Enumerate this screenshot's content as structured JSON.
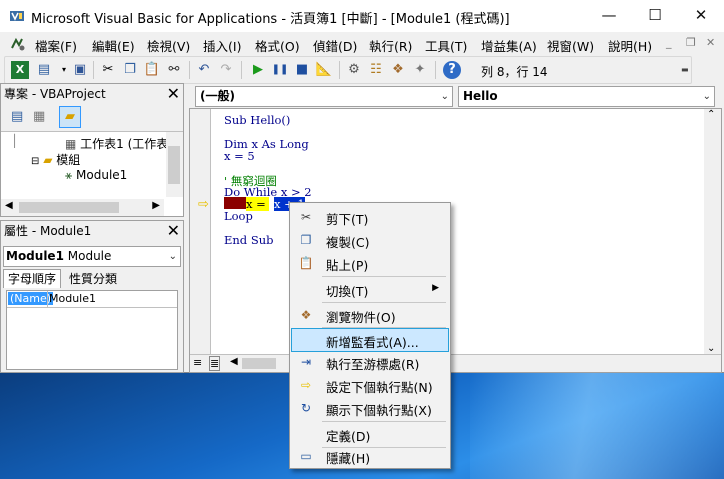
{
  "window": {
    "title": "Microsoft Visual Basic for Applications - 活頁簿1 [中斷] - [Module1 (程式碼)]",
    "controls": {
      "minimize": "—",
      "maximize": "☐",
      "close": "✕"
    }
  },
  "menubar": {
    "items": [
      "檔案(F)",
      "編輯(E)",
      "檢視(V)",
      "插入(I)",
      "格式(O)",
      "偵錯(D)",
      "執行(R)",
      "工具(T)",
      "增益集(A)",
      "視窗(W)",
      "說明(H)"
    ],
    "child_controls": {
      "minimize": "_",
      "restore": "❐",
      "close": "✕"
    }
  },
  "toolbar": {
    "position_label": "列 8，行 14",
    "icons": [
      "excel-icon",
      "insert-module-icon",
      "save-icon",
      "cut-icon",
      "copy-icon",
      "paste-icon",
      "find-icon",
      "undo-icon",
      "redo-icon",
      "run-icon",
      "pause-icon",
      "stop-icon",
      "design-mode-icon",
      "project-explorer-icon",
      "properties-icon",
      "object-browser-icon",
      "toolbox-icon",
      "help-icon"
    ]
  },
  "project_pane": {
    "title": "專案 - VBAProject",
    "tree": {
      "worksheet": "工作表1 (工作表",
      "modules_folder": "模組",
      "module": "Module1"
    }
  },
  "properties_pane": {
    "title": "屬性 - Module1",
    "object_name": "Module1",
    "object_type": "Module",
    "tabs": [
      "字母順序",
      "性質分類"
    ],
    "property": {
      "name": "(Name)",
      "value": "Module1"
    }
  },
  "code_window": {
    "object_combo": "(一般)",
    "procedure_combo": "Hello",
    "lines": {
      "l1": "Sub Hello()",
      "l2": "Dim x As Long",
      "l3": "x = 5",
      "l4": "' 無窮迴圈",
      "l5": "Do While x > 2",
      "l6a": "x = ",
      "l6b": "x + 1",
      "l7": "Loop",
      "l8": "End Sub"
    }
  },
  "context_menu": {
    "items": [
      {
        "label": "剪下(T)",
        "icon": "cut-icon"
      },
      {
        "label": "複製(C)",
        "icon": "copy-icon"
      },
      {
        "label": "貼上(P)",
        "icon": "paste-icon"
      },
      {
        "label": "切換(T)",
        "icon": "",
        "submenu": "▶"
      },
      {
        "label": "瀏覽物件(O)",
        "icon": "object-browser-icon"
      },
      {
        "label": "新增監看式(A)...",
        "icon": ""
      },
      {
        "label": "執行至游標處(R)",
        "icon": "run-to-cursor-icon"
      },
      {
        "label": "設定下個執行點(N)",
        "icon": "set-next-statement-icon"
      },
      {
        "label": "顯示下個執行點(X)",
        "icon": "show-next-statement-icon"
      },
      {
        "label": "定義(D)",
        "icon": ""
      },
      {
        "label": "隱藏(H)",
        "icon": "hide-icon"
      }
    ]
  },
  "colors": {
    "breakpoint_bg": "#8b0000",
    "exec_highlight": "#ffff00",
    "comment": "#008000",
    "keyword": "#00008b",
    "menu_highlight": "#cce8ff"
  }
}
